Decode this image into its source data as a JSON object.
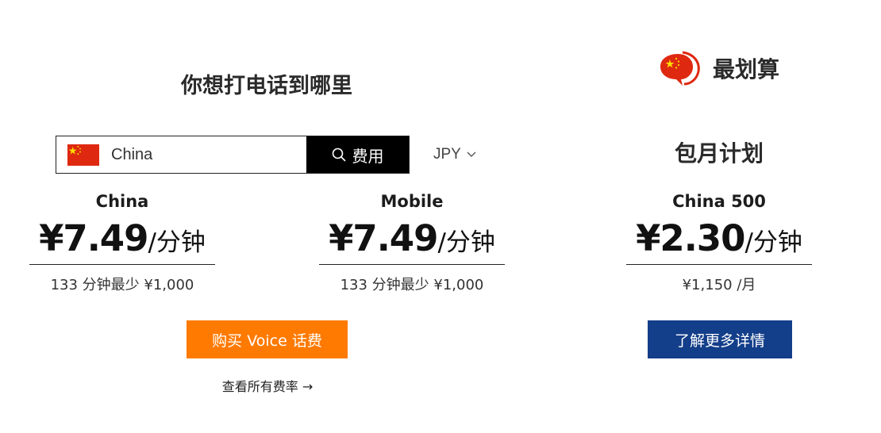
{
  "left_section": {
    "title": "你想打电话到哪里"
  },
  "search": {
    "country_value": "China",
    "button_label": "费用",
    "flag_icon": "china-flag-icon",
    "button_icon": "search-icon"
  },
  "currency": {
    "selected": "JPY",
    "icon": "chevron-down-icon"
  },
  "rates": [
    {
      "name": "China",
      "price": "¥7.49",
      "unit": "/分钟",
      "sub": "133 分钟最少 ¥1,000"
    },
    {
      "name": "Mobile",
      "price": "¥7.49",
      "unit": "/分钟",
      "sub": "133 分钟最少 ¥1,000"
    }
  ],
  "buy_button": {
    "label": "购买 Voice 话费"
  },
  "rates_link": {
    "label": "查看所有费率 →"
  },
  "best_deal": {
    "label": "最划算",
    "icon": "china-flag-chat-icon",
    "plan_heading": "包月计划",
    "plan_name": "China 500",
    "price": "¥2.30",
    "unit": "/分钟",
    "sub": "¥1,150 /月",
    "button_label": "了解更多详情"
  },
  "colors": {
    "buy_button": "#ff7a00",
    "more_button": "#133e8a",
    "search_button": "#000000",
    "flag_red": "#de2910",
    "flag_yellow": "#ffde00"
  }
}
